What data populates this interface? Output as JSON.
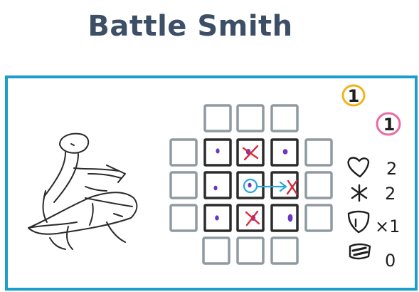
{
  "card": {
    "title": "Battle Smith",
    "costs": [
      {
        "value": "1",
        "color": "#f2b21a"
      },
      {
        "value": "1",
        "color": "#ec6aa4"
      }
    ],
    "stats": [
      {
        "icon": "heart-icon",
        "value": "2"
      },
      {
        "icon": "asterisk-icon",
        "value": "2"
      },
      {
        "icon": "shield-icon",
        "value": "×1"
      },
      {
        "icon": "banner-icon",
        "value": "0"
      }
    ]
  },
  "grid": {
    "outer_color": "#8f9aa0",
    "inner_color": "#2b2b2b",
    "dot_color": "#6b36c0",
    "cross_color": "#d82c3c",
    "arrow_color": "#28a7dd"
  }
}
